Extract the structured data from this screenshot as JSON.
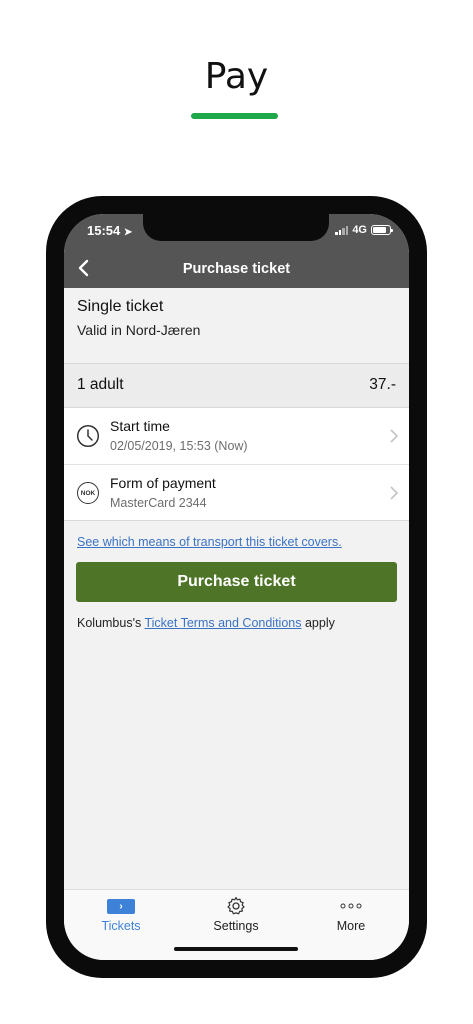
{
  "promo": {
    "title": "Pay"
  },
  "status_bar": {
    "time": "15:54",
    "network": "4G"
  },
  "nav": {
    "title": "Purchase ticket"
  },
  "ticket": {
    "name": "Single ticket",
    "validity": "Valid in Nord-Jæren"
  },
  "passengers": {
    "label": "1 adult",
    "price": "37.-"
  },
  "rows": [
    {
      "title": "Start time",
      "subtitle": "02/05/2019, 15:53 (Now)",
      "icon": "clock-icon"
    },
    {
      "title": "Form of payment",
      "subtitle": "MasterCard 2344",
      "icon": "nok-coin-icon",
      "icon_text": "NOK"
    }
  ],
  "transport_link": "See which means of transport this ticket covers.",
  "purchase_button": "Purchase ticket",
  "terms": {
    "prefix": "Kolumbus's ",
    "link": "Ticket Terms and Conditions",
    "suffix": " apply"
  },
  "tabs": [
    {
      "label": "Tickets",
      "icon": "ticket-icon",
      "active": true
    },
    {
      "label": "Settings",
      "icon": "gear-icon",
      "active": false
    },
    {
      "label": "More",
      "icon": "more-dots-icon",
      "active": false
    }
  ],
  "colors": {
    "accent": "#1fa84a",
    "header": "#555555",
    "button": "#4e7427",
    "link": "#3b73c4",
    "tab_active": "#3d82d8"
  }
}
